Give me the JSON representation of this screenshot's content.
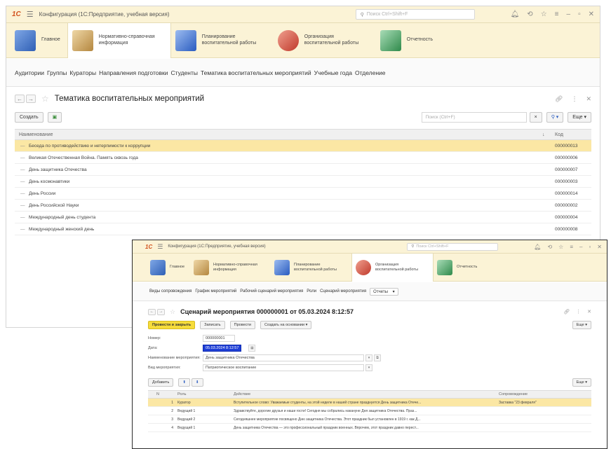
{
  "window1": {
    "app_title": "Конфигурация (1С:Предприятие, учебная версия)",
    "logo": "1С",
    "search_placeholder": "Поиск Ctrl+Shift+F",
    "sections": [
      {
        "label": "Главное",
        "icon": "home-desk-icon",
        "color": "#3b6ec2"
      },
      {
        "label": "Нормативно-справочная информация",
        "icon": "reference-book-icon",
        "color": "#c99a52"
      },
      {
        "label": "Планирование воспитательной работы",
        "icon": "planning-icon",
        "color": "#3b6ec2"
      },
      {
        "label": "Организация воспитательной работы",
        "icon": "organization-icon",
        "color": "#d24b3c"
      },
      {
        "label": "Отчетность",
        "icon": "reports-icon",
        "color": "#3d9a5a"
      }
    ],
    "nav_links": [
      "Аудитории",
      "Группы",
      "Кураторы",
      "Направления подготовки",
      "Студенты",
      "Тематика воспитательных мероприятий",
      "Учебные года",
      "Отделение"
    ],
    "form_title": "Тематика воспитательных мероприятий",
    "create_button": "Создать",
    "list_search_placeholder": "Поиск (Ctrl+F)",
    "more_button": "Еще",
    "columns": {
      "name": "Наименование",
      "code": "Код"
    },
    "rows": [
      {
        "name": "Беседа по противодействию и нетерпимости к коррупции",
        "code": "000000013",
        "selected": true
      },
      {
        "name": "Великая Отечественная Война. Память сквозь года",
        "code": "000000006"
      },
      {
        "name": "День защитника Отечества",
        "code": "000000007"
      },
      {
        "name": "День космонавтики",
        "code": "000000003"
      },
      {
        "name": "День России",
        "code": "000000014"
      },
      {
        "name": "День Российской Науки",
        "code": "000000002"
      },
      {
        "name": "Международный день студента",
        "code": "000000004"
      },
      {
        "name": "Международный женский день",
        "code": "000000008"
      }
    ]
  },
  "window2": {
    "app_title": "Конфигурация (1С:Предприятие, учебная версия)",
    "logo": "1С",
    "search_placeholder": "Поиск Ctrl+Shift+F",
    "sections": [
      {
        "label": "Главное",
        "icon": "home-desk-icon",
        "color": "#3b6ec2"
      },
      {
        "label": "Нормативно-справочная информация",
        "icon": "reference-book-icon",
        "color": "#c99a52"
      },
      {
        "label": "Планирование воспитательной работы",
        "icon": "planning-icon",
        "color": "#3b6ec2"
      },
      {
        "label": "Организация воспитательной работы",
        "icon": "organization-icon",
        "color": "#d24b3c"
      },
      {
        "label": "Отчетность",
        "icon": "reports-icon",
        "color": "#3d9a5a"
      }
    ],
    "nav_links": [
      "Виды сопровождения",
      "График мероприятий",
      "Рабочий сценарий мероприятия",
      "Роли",
      "Сценарий мероприятия"
    ],
    "nav_more": "Отчеты",
    "form_title": "Сценарий мероприятия 000000001 от 05.03.2024 8:12:57",
    "buttons": {
      "post_close": "Провести и закрыть",
      "save": "Записать",
      "post": "Провести",
      "create_based": "Создать на основании",
      "more": "Еще"
    },
    "fields": {
      "number_label": "Номер:",
      "number_value": "000000001",
      "date_label": "Дата:",
      "date_value": "05.03.2024 8:12:57",
      "event_label": "Наименование мероприятия:",
      "event_value": "День защитника Отечества",
      "type_label": "Вид мероприятия:",
      "type_value": "Патриотическое воспитание"
    },
    "table_buttons": {
      "add": "Добавить",
      "more": "Еще"
    },
    "columns": {
      "n": "N",
      "role": "Роль",
      "action": "Действие",
      "accompaniment": "Сопровождение"
    },
    "rows": [
      {
        "n": "1",
        "role": "Куратор",
        "action": "Вступительное слово: Уважаемые студенты, на этой неделе в нашей стране празднуется День защитника Отече...",
        "accompaniment": "Заставка \"23 февраля\"",
        "selected": true
      },
      {
        "n": "2",
        "role": "Ведущий 1",
        "action": "Здравствуйте, дорогие друзья и наши гости! Сегодня мы собрались накануне Дня защитника Отечества. Праз...",
        "accompaniment": ""
      },
      {
        "n": "3",
        "role": "Ведущий 2",
        "action": "Сегодняшнее мероприятие посвящено Дню защитника Отечества. Этот праздник был установлен в 1919 г. как Д...",
        "accompaniment": ""
      },
      {
        "n": "4",
        "role": "Ведущий 1",
        "action": "День защитника Отечества — это профессиональный праздник военных. Впрочем, этот праздник давно перест...",
        "accompaniment": ""
      }
    ]
  }
}
